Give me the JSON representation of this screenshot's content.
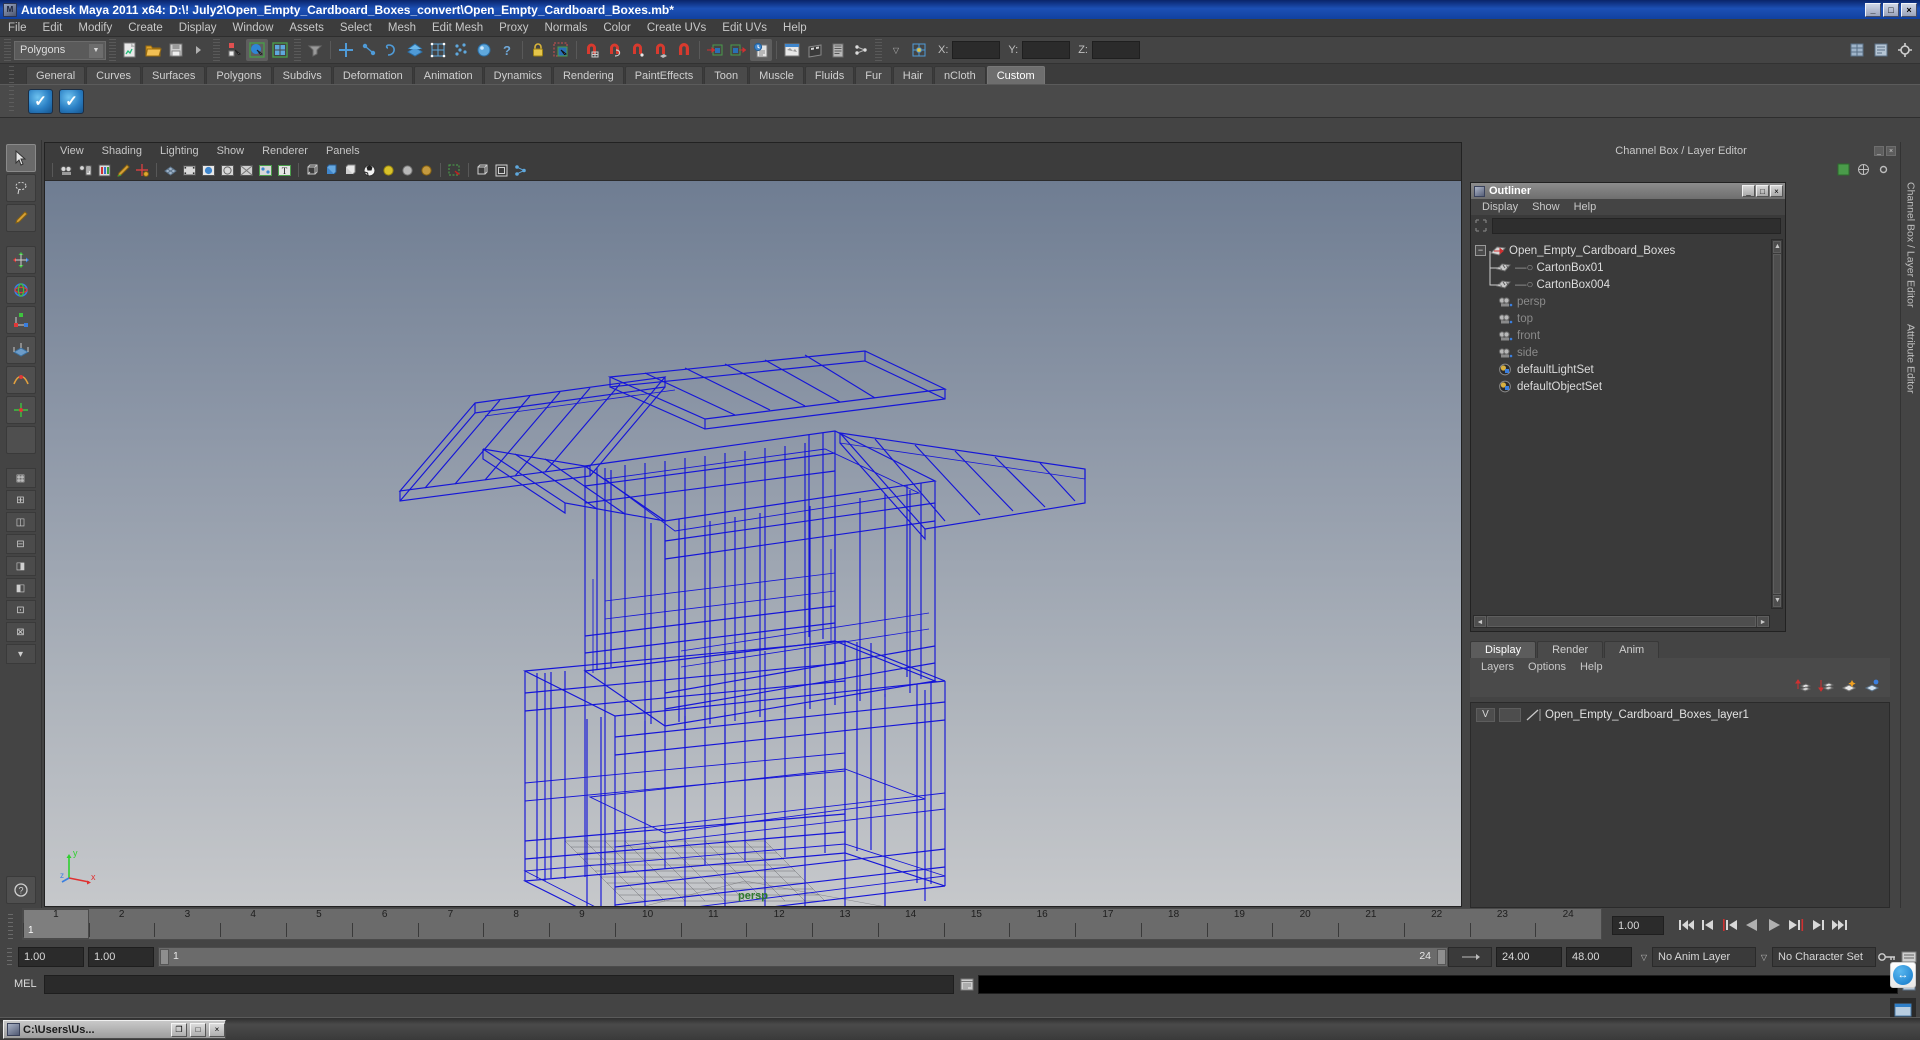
{
  "window": {
    "title": "Autodesk Maya 2011 x64: D:\\! July2\\Open_Empty_Cardboard_Boxes_convert\\Open_Empty_Cardboard_Boxes.mb*",
    "minimize": "_",
    "maximize": "□",
    "close": "×"
  },
  "menubar": {
    "items": [
      {
        "label": "File"
      },
      {
        "label": "Edit"
      },
      {
        "label": "Modify"
      },
      {
        "label": "Create"
      },
      {
        "label": "Display"
      },
      {
        "label": "Window"
      },
      {
        "label": "Assets"
      },
      {
        "label": "Select"
      },
      {
        "label": "Mesh"
      },
      {
        "label": "Edit Mesh"
      },
      {
        "label": "Proxy"
      },
      {
        "label": "Normals"
      },
      {
        "label": "Color"
      },
      {
        "label": "Create UVs"
      },
      {
        "label": "Edit UVs"
      },
      {
        "label": "Help"
      }
    ]
  },
  "toolbar": {
    "menuset": "Polygons",
    "dropdown_arrow": "▼",
    "x_label": "X:",
    "y_label": "Y:",
    "z_label": "Z:",
    "x_value": "",
    "y_value": "",
    "z_value": "",
    "icons": [
      "new-scene-icon",
      "open-scene-icon",
      "save-scene-icon",
      "undo-icon",
      "redo-icon",
      "select-by-hierarchy-icon",
      "select-by-object-icon",
      "select-by-component-icon",
      "select-mask-icon",
      "snap-to-grid-icon",
      "snap-to-curve-icon",
      "snap-to-point-icon",
      "snap-to-projected-center-icon",
      "snap-to-view-plane-icon",
      "construction-history-icon",
      "render-current-frame-icon",
      "ipr-render-icon",
      "render-settings-icon",
      "hypershade-icon",
      "render-view-icon",
      "lock-icon",
      "highlight-selection-icon",
      "playblast-icon",
      "flipbook-icon",
      "relationship-editor-icon",
      "toggle-pivot-icon"
    ]
  },
  "shelf": {
    "tabs": [
      {
        "label": "General",
        "active": false
      },
      {
        "label": "Curves",
        "active": false
      },
      {
        "label": "Surfaces",
        "active": false
      },
      {
        "label": "Polygons",
        "active": false
      },
      {
        "label": "Subdivs",
        "active": false
      },
      {
        "label": "Deformation",
        "active": false
      },
      {
        "label": "Animation",
        "active": false
      },
      {
        "label": "Dynamics",
        "active": false
      },
      {
        "label": "Rendering",
        "active": false
      },
      {
        "label": "PaintEffects",
        "active": false
      },
      {
        "label": "Toon",
        "active": false
      },
      {
        "label": "Muscle",
        "active": false
      },
      {
        "label": "Fluids",
        "active": false
      },
      {
        "label": "Fur",
        "active": false
      },
      {
        "label": "Hair",
        "active": false
      },
      {
        "label": "nCloth",
        "active": false
      },
      {
        "label": "Custom",
        "active": true
      }
    ],
    "items": [
      {
        "name": "custom-shelf-button-1",
        "glyph": "✓"
      },
      {
        "name": "custom-shelf-button-2",
        "glyph": "✓"
      }
    ]
  },
  "toolbox": {
    "tools": [
      {
        "name": "select-tool",
        "glyph": "➤",
        "selected": true
      },
      {
        "name": "lasso-tool",
        "glyph": "◌",
        "selected": false
      },
      {
        "name": "paint-select-tool",
        "glyph": "✎",
        "selected": false
      },
      {
        "name": "move-tool",
        "glyph": "✥",
        "selected": false
      },
      {
        "name": "rotate-tool",
        "glyph": "◍",
        "selected": false
      },
      {
        "name": "scale-tool",
        "glyph": "◈",
        "selected": false
      },
      {
        "name": "universal-manipulator-tool",
        "glyph": "▣",
        "selected": false
      },
      {
        "name": "soft-modification-tool",
        "glyph": "❋",
        "selected": false
      },
      {
        "name": "show-manipulator-tool",
        "glyph": "✛",
        "selected": false
      },
      {
        "name": "last-tool-used",
        "glyph": "",
        "selected": false
      }
    ],
    "layouts": [
      {
        "name": "layout-single-perspective",
        "glyph": "▦"
      },
      {
        "name": "layout-four-view",
        "glyph": "⊞"
      },
      {
        "name": "layout-persp-outliner",
        "glyph": "◫"
      },
      {
        "name": "layout-persp-graph",
        "glyph": "⊟"
      },
      {
        "name": "layout-hypershade-persp",
        "glyph": "◨"
      },
      {
        "name": "layout-persp-hypergraph",
        "glyph": "◧"
      },
      {
        "name": "layout-outliner-persp",
        "glyph": "⊡"
      },
      {
        "name": "layout-persp-uv-editor",
        "glyph": "⊠"
      },
      {
        "name": "layout-expand-selector",
        "glyph": "▾"
      }
    ],
    "help_glyph": "?"
  },
  "viewport": {
    "menu": [
      {
        "label": "View"
      },
      {
        "label": "Shading"
      },
      {
        "label": "Lighting"
      },
      {
        "label": "Show"
      },
      {
        "label": "Renderer"
      },
      {
        "label": "Panels"
      }
    ],
    "icons": [
      "select-camera-icon",
      "camera-attributes-icon",
      "book-icon",
      "paint-icon",
      "lock-camera-icon",
      "grid-toggle-icon",
      "film-gate-icon",
      "resolution-gate-icon",
      "gate-mask-icon",
      "xray-icon",
      "xray-joints-icon",
      "text-annotate-icon",
      "wireframe-shading-icon",
      "smooth-shade-all-icon",
      "smooth-shade-selected-icon",
      "textured-shading-icon",
      "lights-off-icon",
      "default-light-icon",
      "all-lights-icon",
      "shadows-icon",
      "isolate-select-icon",
      "bounding-box-icon",
      "single-perspective-icon",
      "two-pane-icon"
    ],
    "camera_label": "persp",
    "axis": {
      "x": "x",
      "y": "y",
      "z": "z"
    },
    "background_top": "#6f7d92",
    "background_bottom": "#c9cbce",
    "wireframe_color": "#1212d2"
  },
  "channelbox": {
    "header": "Channel Box / Layer Editor",
    "minimize": "_",
    "close": "×",
    "tools": [
      "channel-box-icon",
      "attribute-editor-icon",
      "tool-settings-icon"
    ]
  },
  "outliner": {
    "title": "Outliner",
    "window_buttons": {
      "minimize": "_",
      "maximize": "□",
      "close": "×"
    },
    "menu": [
      {
        "label": "Display"
      },
      {
        "label": "Show"
      },
      {
        "label": "Help"
      }
    ],
    "search_placeholder": "",
    "search_value": "",
    "tree": [
      {
        "label": "Open_Empty_Cardboard_Boxes",
        "icon": "transform-icon",
        "depth": 0,
        "dim": false,
        "expanded": true
      },
      {
        "label": "CartonBox01",
        "icon": "mesh-icon",
        "depth": 1,
        "dim": false,
        "expanded": false
      },
      {
        "label": "CartonBox004",
        "icon": "mesh-icon",
        "depth": 1,
        "dim": false,
        "expanded": false
      },
      {
        "label": "persp",
        "icon": "camera-icon",
        "depth": 1,
        "dim": true,
        "expanded": false
      },
      {
        "label": "top",
        "icon": "camera-icon",
        "depth": 1,
        "dim": true,
        "expanded": false
      },
      {
        "label": "front",
        "icon": "camera-icon",
        "depth": 1,
        "dim": true,
        "expanded": false
      },
      {
        "label": "side",
        "icon": "camera-icon",
        "depth": 1,
        "dim": true,
        "expanded": false
      },
      {
        "label": "defaultLightSet",
        "icon": "set-icon",
        "depth": 1,
        "dim": false,
        "expanded": false
      },
      {
        "label": "defaultObjectSet",
        "icon": "set-icon",
        "depth": 1,
        "dim": false,
        "expanded": false
      }
    ],
    "scroll_up": "▲",
    "scroll_down": "▼",
    "scroll_left": "◄",
    "scroll_right": "►"
  },
  "layer_editor": {
    "tabs": [
      {
        "label": "Display",
        "active": true
      },
      {
        "label": "Render",
        "active": false
      },
      {
        "label": "Anim",
        "active": false
      }
    ],
    "menu": [
      {
        "label": "Layers"
      },
      {
        "label": "Options"
      },
      {
        "label": "Help"
      }
    ],
    "tools": [
      "move-layer-up-icon",
      "move-layer-down-icon",
      "new-layer-icon",
      "new-layer-from-selected-icon"
    ],
    "layers": [
      {
        "visibility": "V",
        "playback": "",
        "name": "Open_Empty_Cardboard_Boxes_layer1",
        "color": "#9a9a9a"
      }
    ]
  },
  "dock": {
    "labels": [
      "Channel Box / Layer Editor",
      "Attribute Editor"
    ]
  },
  "timeslider": {
    "ticks": [
      1,
      2,
      3,
      4,
      5,
      6,
      7,
      8,
      9,
      10,
      11,
      12,
      13,
      14,
      15,
      16,
      17,
      18,
      19,
      20,
      21,
      22,
      23,
      24
    ],
    "current_frame": "1",
    "current_time_field": "1.00",
    "playback_buttons": [
      {
        "name": "go-to-start-button",
        "glyph": "|◀◀"
      },
      {
        "name": "step-back-frame-button",
        "glyph": "|◀"
      },
      {
        "name": "step-back-key-button",
        "glyph": "|◀"
      },
      {
        "name": "play-backwards-button",
        "glyph": "◀"
      },
      {
        "name": "play-forwards-button",
        "glyph": "▶"
      },
      {
        "name": "step-forward-key-button",
        "glyph": "▶|"
      },
      {
        "name": "step-forward-frame-button",
        "glyph": "▶|"
      },
      {
        "name": "go-to-end-button",
        "glyph": "▶▶|"
      }
    ]
  },
  "rangeslider": {
    "anim_start": "1.00",
    "range_start": "1.00",
    "range_bar_start": "1",
    "range_bar_end": "24",
    "range_end": "24.00",
    "anim_end": "48.00",
    "anim_layer": "No Anim Layer",
    "character_set": "No Character Set",
    "dropdown_glyph": "▽",
    "key_icon": "auto-keyframe-icon"
  },
  "commandline": {
    "label": "MEL",
    "input_value": "",
    "output_value": ""
  },
  "taskbar": {
    "window_title": "C:\\Users\\Us...",
    "restore": "❐",
    "maximize": "□",
    "close": "×"
  }
}
